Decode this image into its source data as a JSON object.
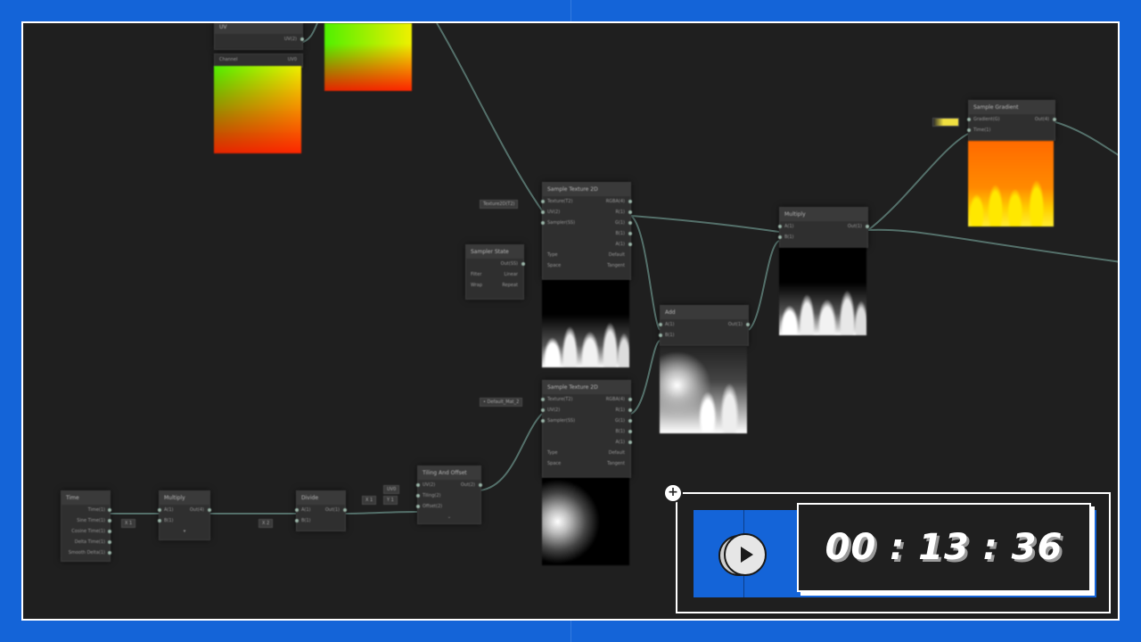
{
  "nodes": {
    "uv": {
      "title": "UV",
      "out": "UV(2)"
    },
    "channel": {
      "title": "Channel",
      "value": "UV0"
    },
    "sample_a": {
      "title": "Sample Texture 2D",
      "rows": [
        "Texture(T2)",
        "UV(2)",
        "Sampler(SS)"
      ],
      "outs": [
        "RGBA(4)",
        "R(1)",
        "G(1)",
        "B(1)",
        "A(1)"
      ],
      "type_label": "Type",
      "type_val": "Default",
      "space_label": "Space",
      "space_val": "Tangent",
      "input_field": "Texture2D(T2)"
    },
    "sampler_state": {
      "title": "Sampler State",
      "out": "Out(SS)",
      "filter_label": "Filter",
      "filter_val": "Linear",
      "wrap_label": "Wrap",
      "wrap_val": "Repeat"
    },
    "sample_b": {
      "title": "Sample Texture 2D",
      "rows": [
        "Texture(T2)",
        "UV(2)",
        "Sampler(SS)"
      ],
      "outs": [
        "RGBA(4)",
        "R(1)",
        "G(1)",
        "B(1)",
        "A(1)"
      ],
      "type_label": "Type",
      "type_val": "Default",
      "space_label": "Space",
      "space_val": "Tangent",
      "input_field": "• Default_Mat_2"
    },
    "add": {
      "title": "Add",
      "in_a": "A(1)",
      "in_b": "B(1)",
      "out": "Out(1)"
    },
    "multiply": {
      "title": "Multiply",
      "in_a": "A(1)",
      "in_b": "B(1)",
      "out": "Out(1)"
    },
    "gradient": {
      "title": "Sample Gradient",
      "in_a": "Gradient(G)",
      "in_b": "Time(1)",
      "out": "Out(4)"
    },
    "time": {
      "title": "Time",
      "rows": [
        "Time(1)",
        "Sine Time(1)",
        "Cosine Time(1)",
        "Delta Time(1)",
        "Smooth Delta(1)"
      ]
    },
    "multiply2": {
      "title": "Multiply",
      "in_a": "A(1)",
      "in_b": "B(1)",
      "out": "Out(4)",
      "field_b": "X 1"
    },
    "divide": {
      "title": "Divide",
      "in_a": "A(1)",
      "in_b": "B(1)",
      "out": "Out(1)",
      "field_b": "X 2"
    },
    "tiling": {
      "title": "Tiling And Offset",
      "rows": [
        "UV(2)",
        "Tiling(2)",
        "Offset(2)"
      ],
      "out": "Out(2)",
      "field_uv": "UV0",
      "field_x": "X 1",
      "field_y": "Y 1"
    }
  },
  "timer": {
    "time": "00 : 13 : 36",
    "add_label": "+"
  },
  "colors": {
    "accent": "#1464d8",
    "canvas": "#1f1f1f",
    "wire": "#5e7f78"
  }
}
